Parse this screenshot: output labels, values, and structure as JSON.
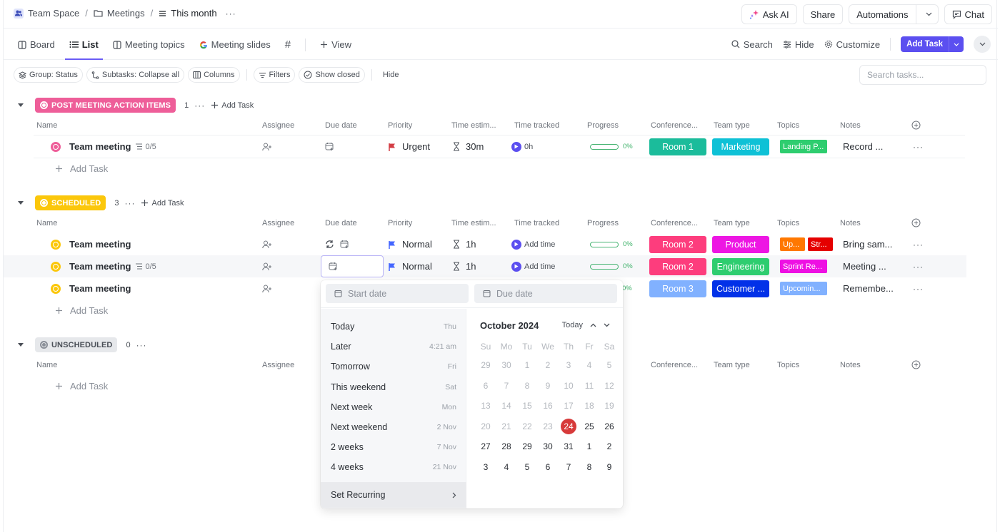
{
  "breadcrumb": {
    "space": "Team Space",
    "folder": "Meetings",
    "list": "This month"
  },
  "top_actions": {
    "ask_ai": "Ask AI",
    "share": "Share",
    "automations": "Automations",
    "chat": "Chat"
  },
  "views": {
    "tabs": [
      {
        "label": "Board",
        "icon": "board-icon"
      },
      {
        "label": "List",
        "icon": "list-icon",
        "active": true
      },
      {
        "label": "Meeting topics",
        "icon": "board-icon"
      },
      {
        "label": "Meeting slides",
        "icon": "google-icon"
      },
      {
        "label": "#",
        "icon": "hash-icon"
      }
    ],
    "add_view": "View",
    "actions": {
      "search": "Search",
      "hide": "Hide",
      "customize": "Customize",
      "add_task": "Add Task"
    }
  },
  "filters": {
    "group": "Group: Status",
    "subtasks": "Subtasks: Collapse all",
    "columns": "Columns",
    "filters": "Filters",
    "show_closed": "Show closed",
    "hide": "Hide",
    "search_placeholder": "Search tasks..."
  },
  "columns": {
    "name": "Name",
    "assignee": "Assignee",
    "due_date": "Due date",
    "priority": "Priority",
    "time_estimate": "Time estim...",
    "time_tracked": "Time tracked",
    "progress": "Progress",
    "conference": "Conference...",
    "team_type": "Team type",
    "topics": "Topics",
    "notes": "Notes"
  },
  "add_task_label": "Add Task",
  "groups": [
    {
      "status": "POST MEETING ACTION ITEMS",
      "color": "#ee5e99",
      "count": "1",
      "tasks": [
        {
          "name": "Team meeting",
          "subtasks": "0/5",
          "priority": "Urgent",
          "priority_color": "#d33d44",
          "estimate": "30m",
          "tracked": "0h",
          "progress": "0%",
          "conference": {
            "label": "Room 1",
            "color": "#1bbc9b"
          },
          "team_type": {
            "label": "Marketing",
            "color": "#0ec1d6"
          },
          "topics": [
            {
              "label": "Landing P...",
              "color": "#2ecd6f"
            }
          ],
          "notes": "Record ..."
        }
      ]
    },
    {
      "status": "SCHEDULED",
      "color": "#fbc70b",
      "count": "3",
      "tasks": [
        {
          "name": "Team meeting",
          "subtasks": "",
          "recurring": true,
          "priority": "Normal",
          "priority_color": "#4466ff",
          "estimate": "1h",
          "tracked": "Add time",
          "progress": "0%",
          "conference": {
            "label": "Room 2",
            "color": "#fd3d7d"
          },
          "team_type": {
            "label": "Product",
            "color": "#ed16e3"
          },
          "topics": [
            {
              "label": "Up...",
              "color": "#ff7800"
            },
            {
              "label": "Str...",
              "color": "#e50000"
            }
          ],
          "notes": "Bring sam..."
        },
        {
          "name": "Team meeting",
          "subtasks": "0/5",
          "priority": "Normal",
          "priority_color": "#4466ff",
          "estimate": "1h",
          "tracked": "Add time",
          "progress": "0%",
          "conference": {
            "label": "Room 2",
            "color": "#fd3d7d"
          },
          "team_type": {
            "label": "Engineering",
            "color": "#2ecd6f"
          },
          "topics": [
            {
              "label": "Sprint Re...",
              "color": "#ee10e3"
            }
          ],
          "notes": "Meeting ..."
        },
        {
          "name": "Team meeting",
          "subtasks": "",
          "priority": "",
          "estimate": "",
          "tracked": "",
          "progress": "0%",
          "conference": {
            "label": "Room 3",
            "color": "#81b1ff"
          },
          "team_type": {
            "label": "Customer ...",
            "color": "#0231e8"
          },
          "topics": [
            {
              "label": "Upcomin...",
              "color": "#81b1ff"
            }
          ],
          "notes": "Remembe..."
        }
      ]
    },
    {
      "status": "UNSCHEDULED",
      "color": "#e6e8eb",
      "count": "0",
      "tasks": []
    }
  ],
  "date_picker": {
    "start_placeholder": "Start date",
    "due_placeholder": "Due date",
    "quick_options": [
      {
        "label": "Today",
        "value": "Thu"
      },
      {
        "label": "Later",
        "value": "4:21 am"
      },
      {
        "label": "Tomorrow",
        "value": "Fri"
      },
      {
        "label": "This weekend",
        "value": "Sat"
      },
      {
        "label": "Next week",
        "value": "Mon"
      },
      {
        "label": "Next weekend",
        "value": "2 Nov"
      },
      {
        "label": "2 weeks",
        "value": "7 Nov"
      },
      {
        "label": "4 weeks",
        "value": "21 Nov"
      }
    ],
    "set_recurring": "Set Recurring",
    "month_label": "October 2024",
    "today_label": "Today",
    "weekdays": [
      "Su",
      "Mo",
      "Tu",
      "We",
      "Th",
      "Fr",
      "Sa"
    ],
    "weeks": [
      [
        "29",
        "30",
        "1",
        "2",
        "3",
        "4",
        "5"
      ],
      [
        "6",
        "7",
        "8",
        "9",
        "10",
        "11",
        "12"
      ],
      [
        "13",
        "14",
        "15",
        "16",
        "17",
        "18",
        "19"
      ],
      [
        "20",
        "21",
        "22",
        "23",
        "24",
        "25",
        "26"
      ],
      [
        "27",
        "28",
        "29",
        "30",
        "31",
        "1",
        "2"
      ],
      [
        "3",
        "4",
        "5",
        "6",
        "7",
        "8",
        "9"
      ]
    ],
    "selected_day": "24",
    "accent_color": "#d73a3a"
  }
}
